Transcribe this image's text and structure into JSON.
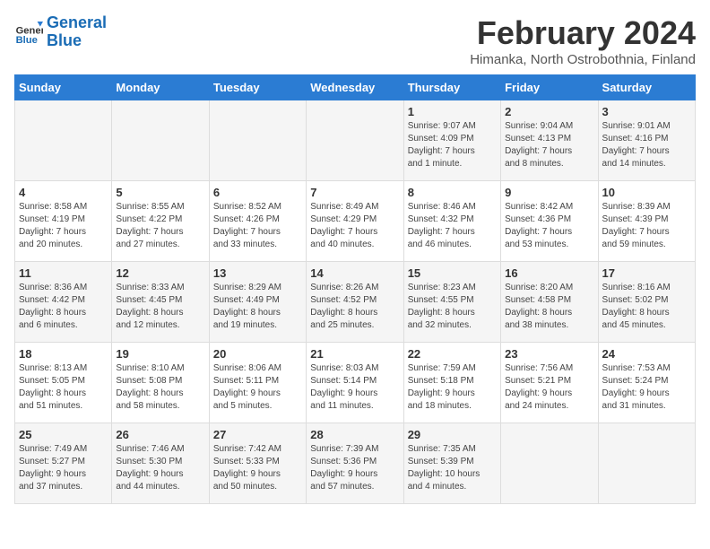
{
  "header": {
    "logo_general": "General",
    "logo_blue": "Blue",
    "title": "February 2024",
    "subtitle": "Himanka, North Ostrobothnia, Finland"
  },
  "weekdays": [
    "Sunday",
    "Monday",
    "Tuesday",
    "Wednesday",
    "Thursday",
    "Friday",
    "Saturday"
  ],
  "weeks": [
    [
      {
        "day": "",
        "info": ""
      },
      {
        "day": "",
        "info": ""
      },
      {
        "day": "",
        "info": ""
      },
      {
        "day": "",
        "info": ""
      },
      {
        "day": "1",
        "info": "Sunrise: 9:07 AM\nSunset: 4:09 PM\nDaylight: 7 hours\nand 1 minute."
      },
      {
        "day": "2",
        "info": "Sunrise: 9:04 AM\nSunset: 4:13 PM\nDaylight: 7 hours\nand 8 minutes."
      },
      {
        "day": "3",
        "info": "Sunrise: 9:01 AM\nSunset: 4:16 PM\nDaylight: 7 hours\nand 14 minutes."
      }
    ],
    [
      {
        "day": "4",
        "info": "Sunrise: 8:58 AM\nSunset: 4:19 PM\nDaylight: 7 hours\nand 20 minutes."
      },
      {
        "day": "5",
        "info": "Sunrise: 8:55 AM\nSunset: 4:22 PM\nDaylight: 7 hours\nand 27 minutes."
      },
      {
        "day": "6",
        "info": "Sunrise: 8:52 AM\nSunset: 4:26 PM\nDaylight: 7 hours\nand 33 minutes."
      },
      {
        "day": "7",
        "info": "Sunrise: 8:49 AM\nSunset: 4:29 PM\nDaylight: 7 hours\nand 40 minutes."
      },
      {
        "day": "8",
        "info": "Sunrise: 8:46 AM\nSunset: 4:32 PM\nDaylight: 7 hours\nand 46 minutes."
      },
      {
        "day": "9",
        "info": "Sunrise: 8:42 AM\nSunset: 4:36 PM\nDaylight: 7 hours\nand 53 minutes."
      },
      {
        "day": "10",
        "info": "Sunrise: 8:39 AM\nSunset: 4:39 PM\nDaylight: 7 hours\nand 59 minutes."
      }
    ],
    [
      {
        "day": "11",
        "info": "Sunrise: 8:36 AM\nSunset: 4:42 PM\nDaylight: 8 hours\nand 6 minutes."
      },
      {
        "day": "12",
        "info": "Sunrise: 8:33 AM\nSunset: 4:45 PM\nDaylight: 8 hours\nand 12 minutes."
      },
      {
        "day": "13",
        "info": "Sunrise: 8:29 AM\nSunset: 4:49 PM\nDaylight: 8 hours\nand 19 minutes."
      },
      {
        "day": "14",
        "info": "Sunrise: 8:26 AM\nSunset: 4:52 PM\nDaylight: 8 hours\nand 25 minutes."
      },
      {
        "day": "15",
        "info": "Sunrise: 8:23 AM\nSunset: 4:55 PM\nDaylight: 8 hours\nand 32 minutes."
      },
      {
        "day": "16",
        "info": "Sunrise: 8:20 AM\nSunset: 4:58 PM\nDaylight: 8 hours\nand 38 minutes."
      },
      {
        "day": "17",
        "info": "Sunrise: 8:16 AM\nSunset: 5:02 PM\nDaylight: 8 hours\nand 45 minutes."
      }
    ],
    [
      {
        "day": "18",
        "info": "Sunrise: 8:13 AM\nSunset: 5:05 PM\nDaylight: 8 hours\nand 51 minutes."
      },
      {
        "day": "19",
        "info": "Sunrise: 8:10 AM\nSunset: 5:08 PM\nDaylight: 8 hours\nand 58 minutes."
      },
      {
        "day": "20",
        "info": "Sunrise: 8:06 AM\nSunset: 5:11 PM\nDaylight: 9 hours\nand 5 minutes."
      },
      {
        "day": "21",
        "info": "Sunrise: 8:03 AM\nSunset: 5:14 PM\nDaylight: 9 hours\nand 11 minutes."
      },
      {
        "day": "22",
        "info": "Sunrise: 7:59 AM\nSunset: 5:18 PM\nDaylight: 9 hours\nand 18 minutes."
      },
      {
        "day": "23",
        "info": "Sunrise: 7:56 AM\nSunset: 5:21 PM\nDaylight: 9 hours\nand 24 minutes."
      },
      {
        "day": "24",
        "info": "Sunrise: 7:53 AM\nSunset: 5:24 PM\nDaylight: 9 hours\nand 31 minutes."
      }
    ],
    [
      {
        "day": "25",
        "info": "Sunrise: 7:49 AM\nSunset: 5:27 PM\nDaylight: 9 hours\nand 37 minutes."
      },
      {
        "day": "26",
        "info": "Sunrise: 7:46 AM\nSunset: 5:30 PM\nDaylight: 9 hours\nand 44 minutes."
      },
      {
        "day": "27",
        "info": "Sunrise: 7:42 AM\nSunset: 5:33 PM\nDaylight: 9 hours\nand 50 minutes."
      },
      {
        "day": "28",
        "info": "Sunrise: 7:39 AM\nSunset: 5:36 PM\nDaylight: 9 hours\nand 57 minutes."
      },
      {
        "day": "29",
        "info": "Sunrise: 7:35 AM\nSunset: 5:39 PM\nDaylight: 10 hours\nand 4 minutes."
      },
      {
        "day": "",
        "info": ""
      },
      {
        "day": "",
        "info": ""
      }
    ]
  ]
}
